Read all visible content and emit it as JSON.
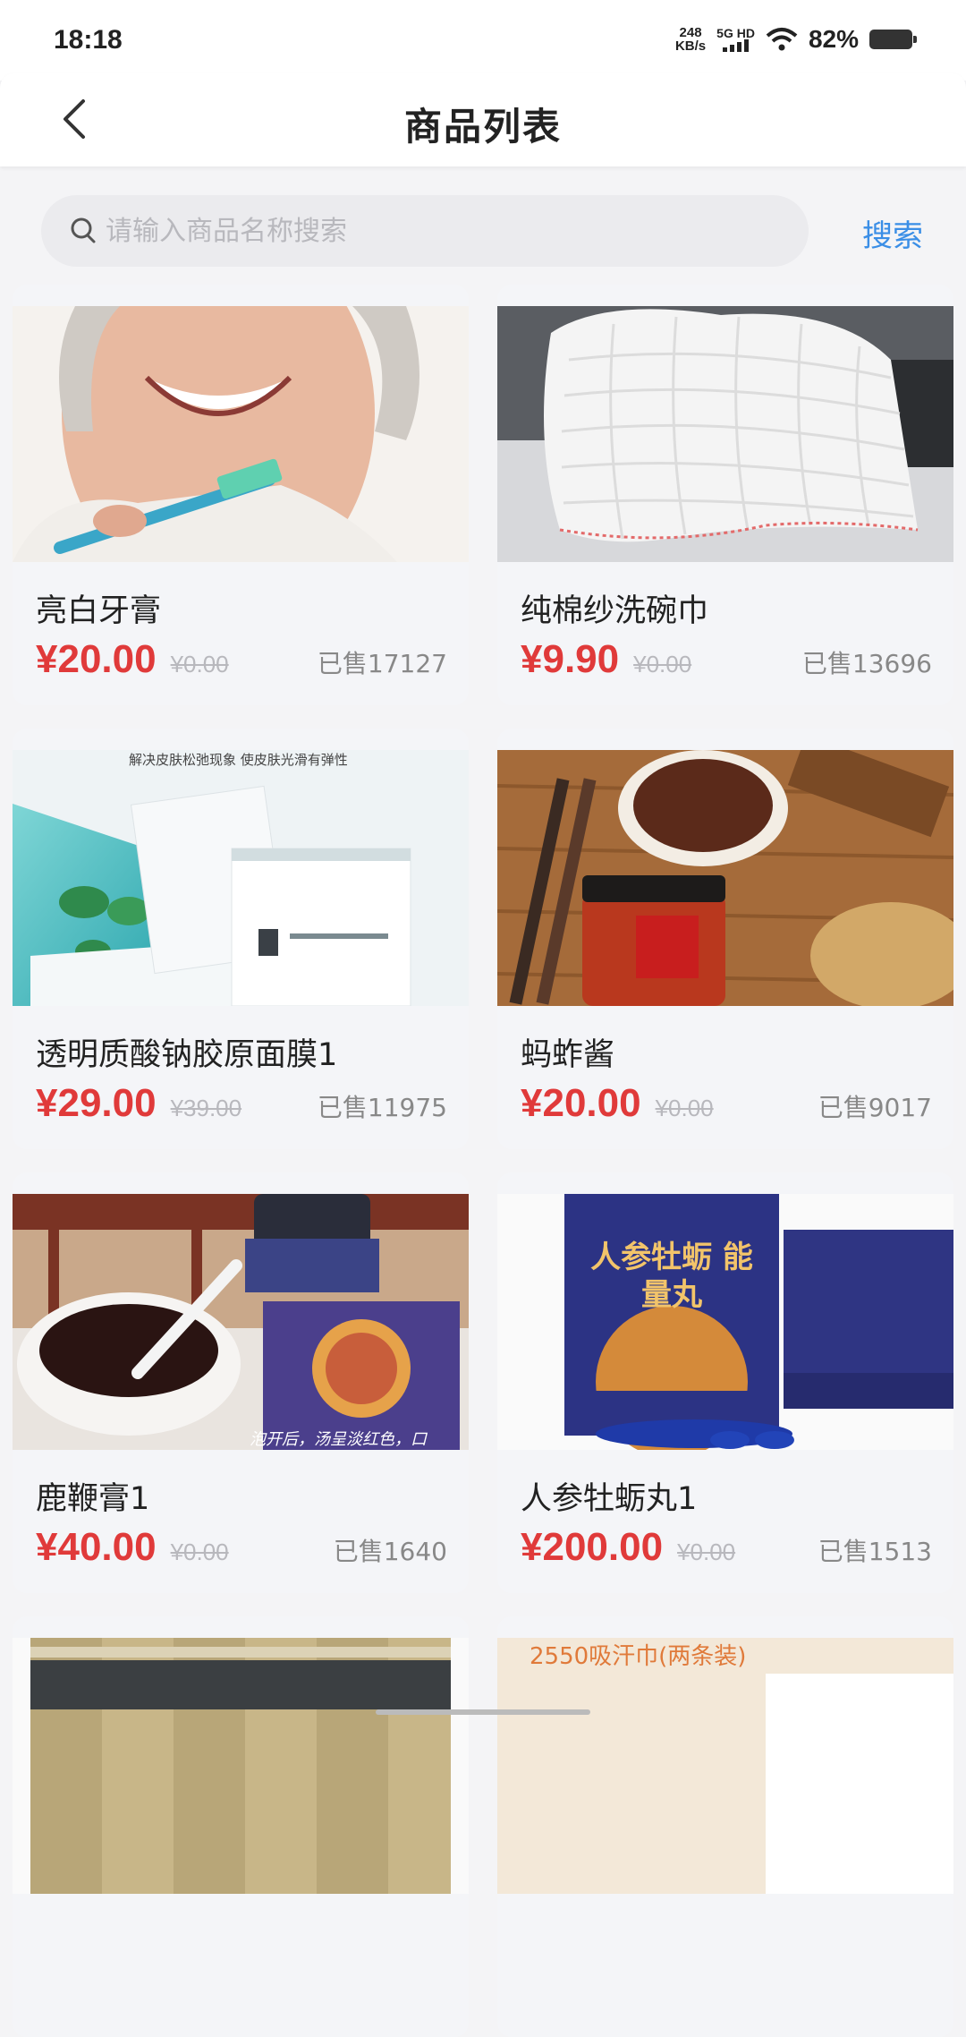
{
  "status_bar": {
    "time": "18:18",
    "net_speed_value": "248",
    "net_speed_unit": "KB/s",
    "network": "5G HD",
    "battery": "82%"
  },
  "header": {
    "title": "商品列表"
  },
  "search": {
    "placeholder": "请输入商品名称搜索",
    "button_label": "搜索"
  },
  "products": [
    {
      "name": "亮白牙膏",
      "price": "¥20.00",
      "original_price": "¥0.00",
      "sold": "已售17127",
      "image": "toothpaste-photo"
    },
    {
      "name": "纯棉纱洗碗巾",
      "price": "¥9.90",
      "original_price": "¥0.00",
      "sold": "已售13696",
      "image": "dish-towel-photo"
    },
    {
      "name": "透明质酸钠胶原面膜1",
      "price": "¥29.00",
      "original_price": "¥39.00",
      "sold": "已售11975",
      "image": "face-mask-photo",
      "image_caption": "解决皮肤松弛现象 使皮肤光滑有弹性"
    },
    {
      "name": "蚂蚱酱",
      "price": "¥20.00",
      "original_price": "¥0.00",
      "sold": "已售9017",
      "image": "grasshopper-sauce-photo"
    },
    {
      "name": "鹿鞭膏1",
      "price": "¥40.00",
      "original_price": "¥0.00",
      "sold": "已售1640",
      "image": "deer-paste-photo",
      "image_caption": "泡开后，汤呈淡红色，口"
    },
    {
      "name": "人参牡蛎丸1",
      "price": "¥200.00",
      "original_price": "¥0.00",
      "sold": "已售1513",
      "image": "ginseng-oyster-photo",
      "image_caption": "人参牡蛎 能量丸"
    },
    {
      "image": "incense-photo"
    },
    {
      "image": "sweat-towel-photo",
      "image_caption": "2550吸汗巾(两条装)"
    }
  ],
  "colors": {
    "price": "#e03a3a",
    "accent": "#3a8ee6"
  }
}
